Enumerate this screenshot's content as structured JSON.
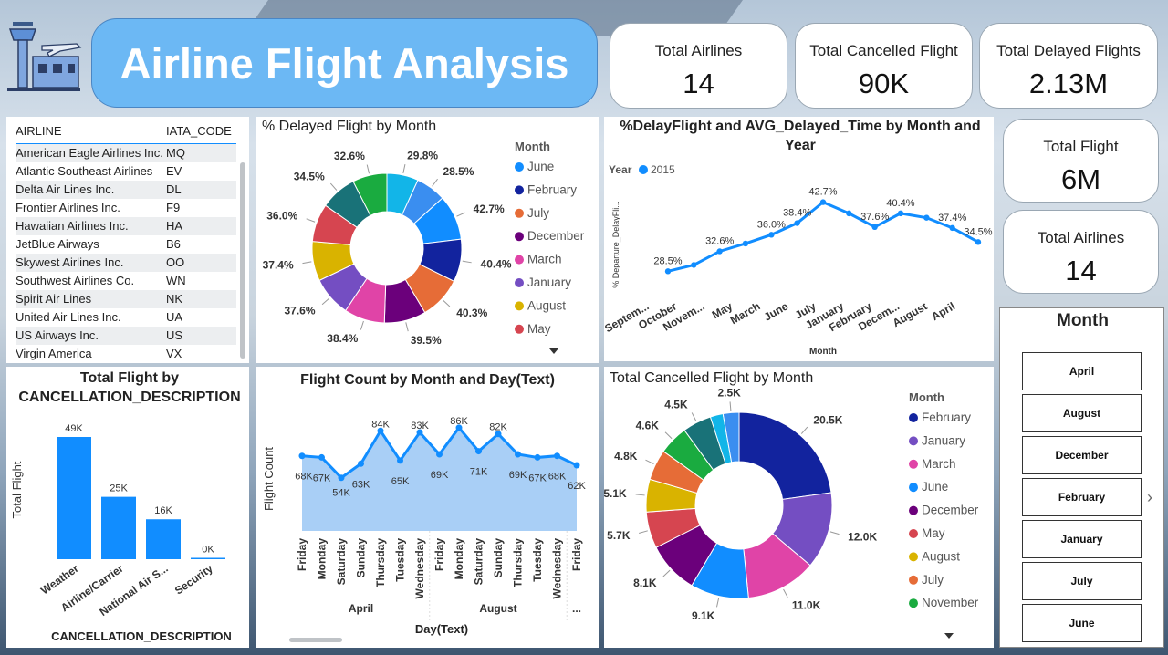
{
  "header": {
    "title": "Airline Flight Analysis",
    "logo_icon": "airport-tower-icon"
  },
  "kpis": {
    "total_airlines": {
      "label": "Total Airlines",
      "value": "14"
    },
    "total_cancelled": {
      "label": "Total Cancelled Flight",
      "value": "90K"
    },
    "total_delayed": {
      "label": "Total Delayed Flights",
      "value": "2.13M"
    },
    "total_flight": {
      "label": "Total Flight",
      "value": "6M"
    },
    "total_airlines_2": {
      "label": "Total Airlines",
      "value": "14"
    }
  },
  "airline_table": {
    "columns": [
      "AIRLINE",
      "IATA_CODE"
    ],
    "rows": [
      [
        "American Eagle Airlines Inc.",
        "MQ"
      ],
      [
        "Atlantic Southeast Airlines",
        "EV"
      ],
      [
        "Delta Air Lines Inc.",
        "DL"
      ],
      [
        "Frontier Airlines Inc.",
        "F9"
      ],
      [
        "Hawaiian Airlines Inc.",
        "HA"
      ],
      [
        "JetBlue Airways",
        "B6"
      ],
      [
        "Skywest Airlines Inc.",
        "OO"
      ],
      [
        "Southwest Airlines Co.",
        "WN"
      ],
      [
        "Spirit Air Lines",
        "NK"
      ],
      [
        "United Air Lines Inc.",
        "UA"
      ],
      [
        "US Airways Inc.",
        "US"
      ],
      [
        "Virgin America",
        "VX"
      ]
    ]
  },
  "month_slicer": {
    "title": "Month",
    "items": [
      "April",
      "August",
      "December",
      "February",
      "January",
      "July",
      "June"
    ],
    "next_icon": "chevron-right-icon"
  },
  "chart_data": [
    {
      "type": "pie",
      "title": "% Delayed Flight by Month",
      "legend_title": "Month",
      "legend_placement": "right",
      "legend": [
        "June",
        "February",
        "July",
        "December",
        "March",
        "January",
        "August",
        "May"
      ],
      "slices": [
        {
          "label": "29.8%",
          "value": 29.8,
          "color": "#12b5e8"
        },
        {
          "label": "28.5%",
          "value": 28.5,
          "color": "#3a8ef0"
        },
        {
          "label": "42.7%",
          "value": 42.7,
          "color": "#118dff"
        },
        {
          "label": "40.4%",
          "value": 40.4,
          "color": "#12239e"
        },
        {
          "label": "40.3%",
          "value": 40.3,
          "color": "#e66c37"
        },
        {
          "label": "39.5%",
          "value": 39.5,
          "color": "#6b007b"
        },
        {
          "label": "38.4%",
          "value": 38.4,
          "color": "#e044a7"
        },
        {
          "label": "37.6%",
          "value": 37.6,
          "color": "#744ec2"
        },
        {
          "label": "37.4%",
          "value": 37.4,
          "color": "#d9b300"
        },
        {
          "label": "36.0%",
          "value": 36.0,
          "color": "#d64550"
        },
        {
          "label": "34.5%",
          "value": 34.5,
          "color": "#197278"
        },
        {
          "label": "32.6%",
          "value": 32.6,
          "color": "#1aab40"
        }
      ],
      "legend_colors": [
        "#118dff",
        "#12239e",
        "#e66c37",
        "#6b007b",
        "#e044a7",
        "#744ec2",
        "#d9b300",
        "#d64550"
      ]
    },
    {
      "type": "line",
      "title": "%DelayFlight and AVG_Delayed_Time by Month and Year",
      "legend_title": "Year",
      "series": [
        {
          "name": "2015",
          "color": "#118dff",
          "values": [
            28.5,
            29.8,
            32.6,
            34.2,
            36.0,
            38.4,
            42.7,
            40.4,
            37.6,
            40.4,
            39.5,
            37.4,
            34.5
          ]
        }
      ],
      "data_labels": [
        "28.5%",
        "",
        "32.6%",
        "",
        "36.0%",
        "38.4%",
        "42.7%",
        "",
        "37.6%",
        "40.4%",
        "",
        "37.4%",
        "34.5%"
      ],
      "categories": [
        "Septem...",
        "October",
        "Novem...",
        "May",
        "March",
        "June",
        "July",
        "January",
        "February",
        "Decem...",
        "August",
        "April"
      ],
      "xlabel": "Month",
      "ylabel": "% Departure_DelayFli..."
    },
    {
      "type": "bar",
      "title": "Total Flight by CANCELLATION_DESCRIPTION",
      "categories": [
        "Weather",
        "Airline/Carrier",
        "National Air S...",
        "Security"
      ],
      "values": [
        49,
        25,
        16,
        0
      ],
      "value_labels": [
        "49K",
        "25K",
        "16K",
        "0K"
      ],
      "xlabel": "CANCELLATION_DESCRIPTION",
      "ylabel": "Total Flight",
      "color": "#118dff"
    },
    {
      "type": "area",
      "title": "Flight Count by Month and Day(Text)",
      "categories": [
        "Friday",
        "Monday",
        "Saturday",
        "Sunday",
        "Thursday",
        "Tuesday",
        "Wednesday",
        "Friday",
        "Monday",
        "Saturday",
        "Sunday",
        "Thursday",
        "Tuesday",
        "Wednesday",
        "Friday"
      ],
      "groups": [
        {
          "label": "April",
          "span": 7
        },
        {
          "label": "August",
          "span": 7
        },
        {
          "label": "...",
          "span": 1
        }
      ],
      "values": [
        68,
        67,
        54,
        63,
        84,
        65,
        83,
        69,
        86,
        71,
        82,
        69,
        67,
        68,
        62
      ],
      "value_labels": [
        "68K",
        "67K",
        "54K",
        "63K",
        "84K",
        "65K",
        "83K",
        "69K",
        "86K",
        "71K",
        "82K",
        "69K",
        "67K",
        "68K",
        "62K"
      ],
      "xlabel": "Day(Text)",
      "ylabel": "Flight Count",
      "color": "#118dff"
    },
    {
      "type": "pie",
      "title": "Total Cancelled Flight by Month",
      "legend_title": "Month",
      "legend_placement": "right",
      "legend": [
        "February",
        "January",
        "March",
        "June",
        "December",
        "May",
        "August",
        "July",
        "November"
      ],
      "slices": [
        {
          "label": "20.5K",
          "value": 20.5,
          "color": "#12239e"
        },
        {
          "label": "12.0K",
          "value": 12.0,
          "color": "#744ec2"
        },
        {
          "label": "11.0K",
          "value": 11.0,
          "color": "#e044a7"
        },
        {
          "label": "9.1K",
          "value": 9.1,
          "color": "#118dff"
        },
        {
          "label": "8.1K",
          "value": 8.1,
          "color": "#6b007b"
        },
        {
          "label": "5.7K",
          "value": 5.7,
          "color": "#d64550"
        },
        {
          "label": "5.1K",
          "value": 5.1,
          "color": "#d9b300"
        },
        {
          "label": "4.8K",
          "value": 4.8,
          "color": "#e66c37"
        },
        {
          "label": "4.6K",
          "value": 4.6,
          "color": "#1aab40"
        },
        {
          "label": "4.5K",
          "value": 4.5,
          "color": "#197278"
        },
        {
          "label": "",
          "value": 2.0,
          "color": "#12b5e8"
        },
        {
          "label": "2.5K",
          "value": 2.5,
          "color": "#3a8ef0"
        }
      ],
      "legend_colors": [
        "#12239e",
        "#744ec2",
        "#e044a7",
        "#118dff",
        "#6b007b",
        "#d64550",
        "#d9b300",
        "#e66c37",
        "#1aab40"
      ]
    }
  ]
}
